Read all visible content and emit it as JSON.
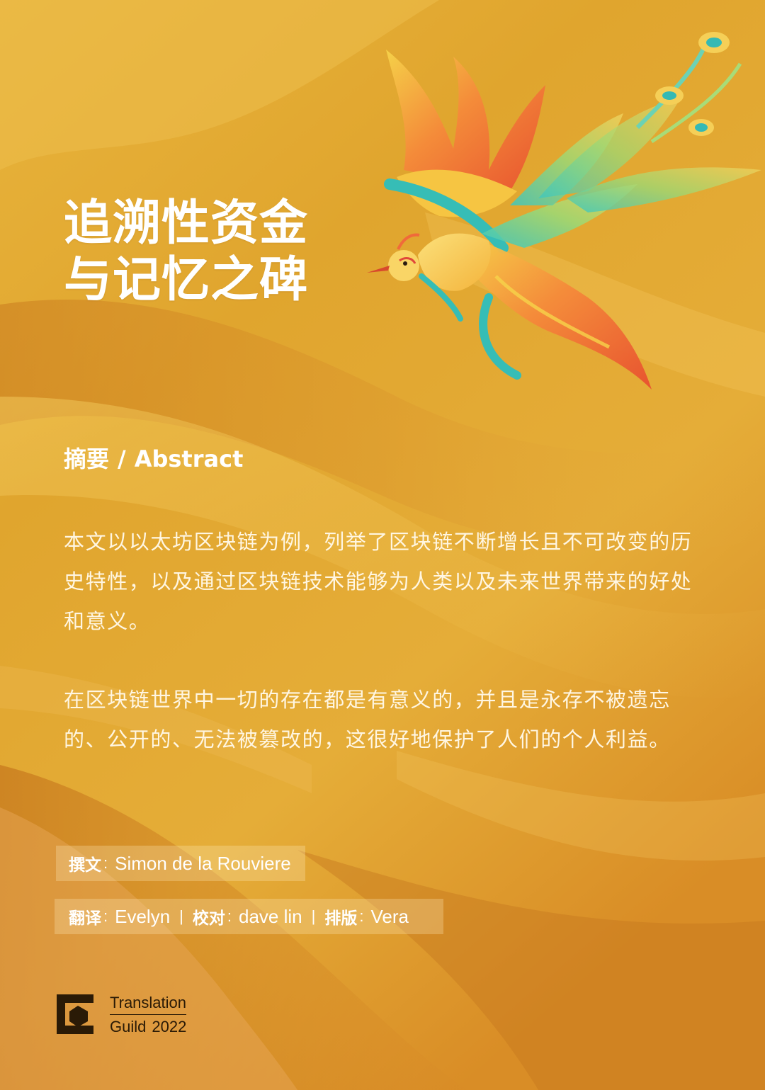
{
  "poster": {
    "title_line1": "追溯性资金",
    "title_line2": "与记忆之碑",
    "abstract_heading_zh": "摘要",
    "abstract_heading_sep": "/",
    "abstract_heading_en": "Abstract",
    "paragraph1": "本文以以太坊区块链为例，列举了区块链不断增长且不可改变的历史特性，以及通过区块链技术能够为人类以及未来世界带来的好处和意义。",
    "paragraph2": "在区块链世界中一切的存在都是有意义的，并且是永存不被遗忘的、公开的、无法被篡改的，这很好地保护了人们的个人利益。"
  },
  "credits": {
    "author_label": "撰文",
    "author_name": "Simon de la Rouviere",
    "colon": ":",
    "divider": "|",
    "translator_label": "翻译",
    "translator_name": "Evelyn",
    "proofreader_label": "校对",
    "proofreader_name": "dave lin",
    "layout_label": "排版",
    "layout_name": "Vera"
  },
  "logo": {
    "line1": "Translation",
    "line2_word": "Guild",
    "line2_year": "2022",
    "icon": "translation-guild-logo-icon"
  },
  "colors": {
    "background": "#e2a62e",
    "text": "#ffffff",
    "logo": "#2a1a06"
  }
}
